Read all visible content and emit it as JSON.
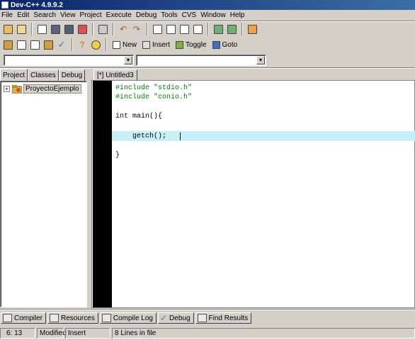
{
  "window": {
    "title": "Dev-C++ 4.9.9.2"
  },
  "menu": [
    "File",
    "Edit",
    "Search",
    "View",
    "Project",
    "Execute",
    "Debug",
    "Tools",
    "CVS",
    "Window",
    "Help"
  ],
  "toolbar2": {
    "new_label": "New",
    "insert_label": "Insert",
    "toggle_label": "Toggle",
    "goto_label": "Goto"
  },
  "left_tabs": [
    "Project",
    "Classes",
    "Debug"
  ],
  "project_tree": {
    "root_label": "ProyectoEjemplo",
    "expander": "+"
  },
  "editor": {
    "tab_label": "[*] Untitled3",
    "lines": [
      "#include \"stdio.h\"",
      "#include \"conio.h\"",
      "",
      "int main(){",
      "",
      "    getch();",
      "",
      "}"
    ]
  },
  "bottom_tabs": [
    "Compiler",
    "Resources",
    "Compile Log",
    "Debug",
    "Find Results"
  ],
  "status": {
    "position": "6: 13",
    "modified": "Modified",
    "mode": "Insert",
    "lines": "8 Lines in file"
  },
  "colors": {
    "title_bar": "#0a246a",
    "keyword_green": "#008000",
    "active_line": "#c8f0f8",
    "gutter": "#000000"
  }
}
